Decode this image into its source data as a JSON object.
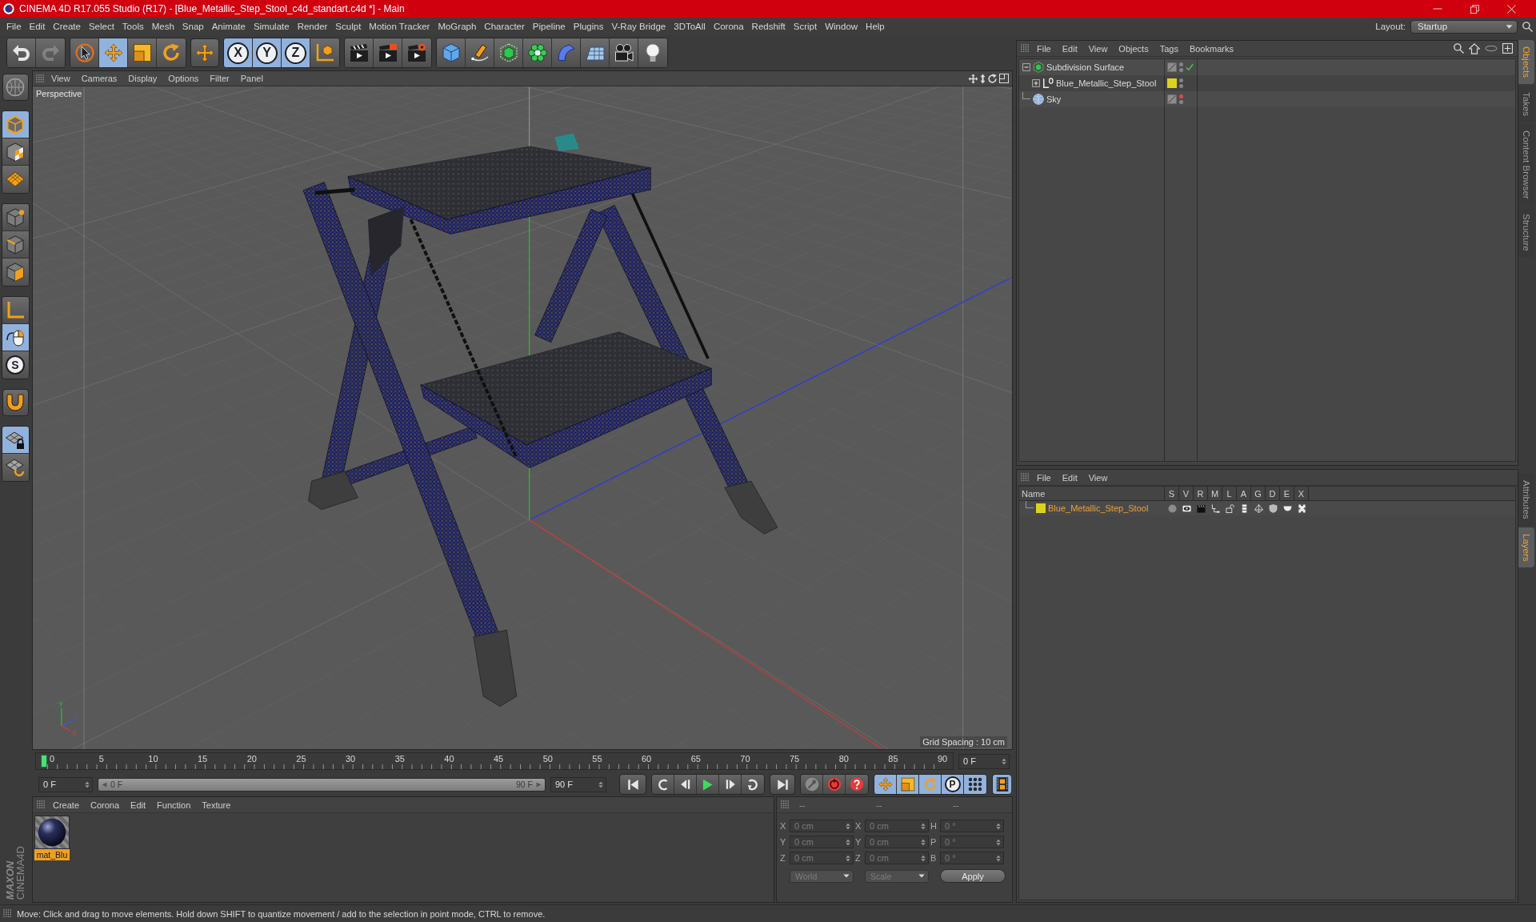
{
  "title_bar": {
    "title": "CINEMA 4D R17.055 Studio (R17) - [Blue_Metallic_Step_Stool_c4d_standart.c4d *] - Main"
  },
  "menu_bar": {
    "items": [
      "File",
      "Edit",
      "Create",
      "Select",
      "Tools",
      "Mesh",
      "Snap",
      "Animate",
      "Simulate",
      "Render",
      "Sculpt",
      "Motion Tracker",
      "MoGraph",
      "Character",
      "Pipeline",
      "Plugins",
      "V-Ray Bridge",
      "3DToAll",
      "Corona",
      "Redshift",
      "Script",
      "Window",
      "Help"
    ],
    "layout_label": "Layout:",
    "layout_value": "Startup"
  },
  "toolbar": [
    [
      {
        "selected": false,
        "disabled": false
      },
      {
        "selected": false,
        "disabled": true
      }
    ],
    [
      {
        "selected": false
      },
      {
        "selected": true
      },
      {
        "selected": false
      },
      {
        "selected": false
      }
    ],
    [
      {
        "selected": false
      }
    ],
    [
      {
        "label": "X",
        "selected": true
      },
      {
        "label": "Y",
        "selected": true
      },
      {
        "label": "Z",
        "selected": true
      },
      {
        "selected": false
      }
    ],
    [
      {
        "selected": false
      },
      {
        "selected": false
      },
      {
        "selected": false
      }
    ],
    [
      {
        "selected": false
      },
      {
        "selected": false
      },
      {
        "selected": false
      },
      {
        "selected": false
      },
      {
        "selected": false
      },
      {
        "selected": false
      },
      {
        "selected": false
      },
      {
        "selected": false
      }
    ]
  ],
  "left_toolbar": [
    [
      {
        "selected": false
      }
    ],
    [
      {
        "selected": true
      },
      {
        "selected": false
      },
      {
        "selected": false
      }
    ],
    [
      {
        "selected": false
      },
      {
        "selected": false
      },
      {
        "selected": false
      }
    ],
    [
      {
        "selected": false
      },
      {
        "selected": true
      },
      {
        "label": "S",
        "selected": false
      }
    ],
    [
      {
        "selected": false
      }
    ],
    [
      {
        "selected": true
      },
      {
        "selected": false
      }
    ]
  ],
  "viewport": {
    "menu": [
      "View",
      "Cameras",
      "Display",
      "Options",
      "Filter",
      "Panel"
    ],
    "camera": "Perspective",
    "grid_spacing": "Grid Spacing : 10 cm",
    "axis_labels": [
      "Y",
      "Z",
      "X"
    ]
  },
  "timeline": {
    "labels": [
      "0",
      "5",
      "10",
      "15",
      "20",
      "25",
      "30",
      "35",
      "40",
      "45",
      "50",
      "55",
      "60",
      "65",
      "70",
      "75",
      "80",
      "85",
      "90"
    ],
    "level": 0,
    "current_frame": "0 F"
  },
  "playback": {
    "start_field": "0 F",
    "range": {
      "start": "0 F",
      "end": "90 F",
      "level": 1
    },
    "end_field": "90 F",
    "modes": [
      {
        "selected": true
      },
      {
        "selected": true
      },
      {
        "selected": true
      },
      {
        "label": "P",
        "selected": true
      },
      {
        "selected": true
      }
    ],
    "timeline_view": {
      "selected": true
    }
  },
  "material_manager": {
    "menu": [
      "Create",
      "Corona",
      "Edit",
      "Function",
      "Texture"
    ],
    "materials": [
      {
        "name": "mat_Blu",
        "selected": true
      }
    ]
  },
  "coordinates": {
    "headers": [
      "--",
      "--",
      "--"
    ],
    "disabled": true,
    "rows": [
      {
        "axis": "X",
        "position": "0 cm",
        "size_axis": "X",
        "size": "0 cm",
        "rot_axis": "H",
        "rotation": "0 °"
      },
      {
        "axis": "Y",
        "position": "0 cm",
        "size_axis": "Y",
        "size": "0 cm",
        "rot_axis": "P",
        "rotation": "0 °"
      },
      {
        "axis": "Z",
        "position": "0 cm",
        "size_axis": "Z",
        "size": "0 cm",
        "rot_axis": "B",
        "rotation": "0 °"
      }
    ],
    "dropdowns": [
      "World",
      "Scale"
    ],
    "apply": "Apply"
  },
  "logo": {
    "brand": "MAXON",
    "product": "CINEMA4D"
  },
  "object_manager": {
    "menu": [
      "File",
      "Edit",
      "View",
      "Objects",
      "Tags",
      "Bookmarks"
    ],
    "objects": [
      {
        "name": "Subdivision Surface",
        "kind": "subdivision",
        "expanded": true,
        "dots": [
          {
            "color": "#858585"
          },
          {
            "color": "#858585"
          }
        ],
        "enabled": true,
        "children": [
          {
            "name": "Blue_Metallic_Step_Stool",
            "kind": "null",
            "expanded": false,
            "color": "#dcd21e",
            "dots": [
              {
                "color": "#858585"
              },
              {
                "color": "#858585"
              }
            ]
          }
        ]
      },
      {
        "name": "Sky",
        "kind": "sky",
        "dots": [
          {
            "color": "#e04848"
          },
          {
            "color": "#858585"
          }
        ]
      }
    ]
  },
  "layer_manager": {
    "menu": [
      "File",
      "Edit",
      "View"
    ],
    "columns": [
      "Name",
      "S",
      "V",
      "R",
      "M",
      "L",
      "A",
      "G",
      "D",
      "E",
      "X"
    ],
    "layers": [
      {
        "name": "Blue_Metallic_Step_Stool",
        "color": "#dcd21e",
        "selected": true
      }
    ]
  },
  "side_tabs": {
    "top": [
      {
        "label": "Objects",
        "selected": true
      },
      {
        "label": "Takes",
        "selected": false
      },
      {
        "label": "Content Browser",
        "selected": false
      },
      {
        "label": "Structure",
        "selected": false
      }
    ],
    "bottom": [
      {
        "label": "Attributes",
        "selected": false
      },
      {
        "label": "Layers",
        "selected": true
      }
    ]
  },
  "status_bar": {
    "text": "Move: Click and drag to move elements. Hold down SHIFT to quantize movement / add to the selection in point mode, CTRL to remove."
  }
}
